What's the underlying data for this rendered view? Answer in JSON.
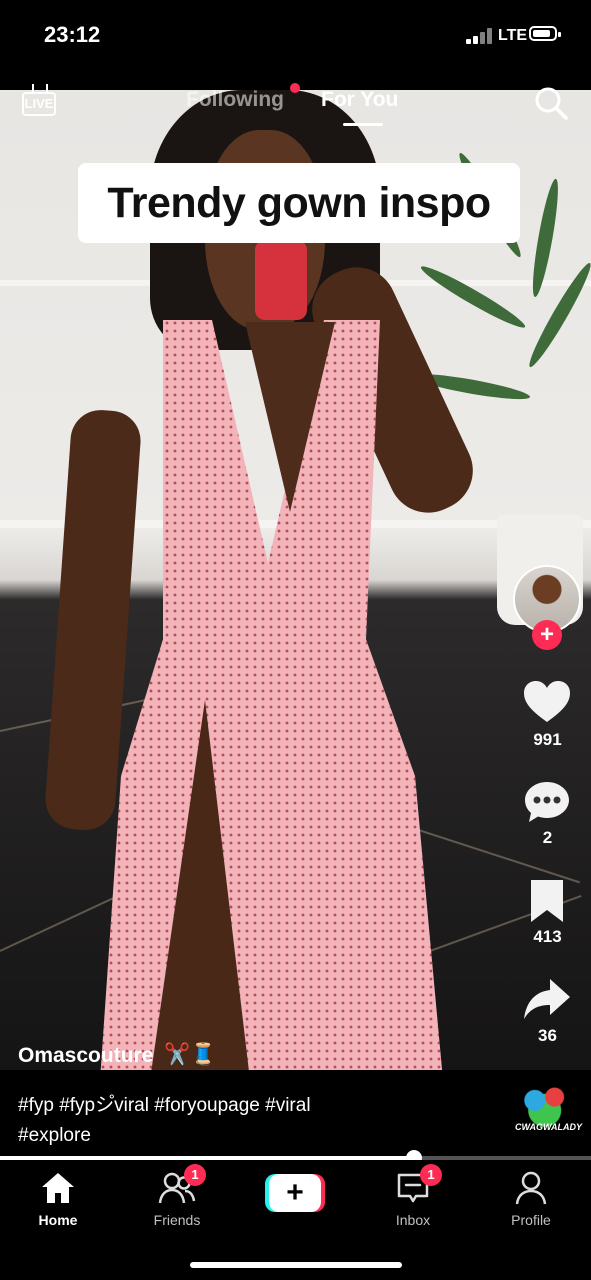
{
  "status_bar": {
    "time": "23:12",
    "network": "LTE"
  },
  "top_tabs": {
    "live_label": "LIVE",
    "following": "Following",
    "for_you": "For You"
  },
  "video": {
    "caption_overlay": "Trendy gown inspo",
    "progress": 0.7
  },
  "actions": {
    "likes": "991",
    "comments": "2",
    "saves": "413",
    "shares": "36"
  },
  "post": {
    "author": "Omascouture",
    "author_emoji": "✂️🧵",
    "description_line1": "#fyp #fypシ゚viral #foryoupage #viral",
    "description_line2": "#explore"
  },
  "music": {
    "label": "CWAGWALADY"
  },
  "bottom_nav": {
    "home": "Home",
    "friends": "Friends",
    "friends_badge": "1",
    "inbox": "Inbox",
    "inbox_badge": "1",
    "profile": "Profile"
  },
  "colors": {
    "accent": "#fe2c55",
    "cyan": "#25f4ee",
    "background": "#000000"
  },
  "icons": [
    "live-icon",
    "search-icon",
    "heart-icon",
    "comment-icon",
    "bookmark-icon",
    "share-icon",
    "home-icon",
    "friends-icon",
    "plus-icon",
    "inbox-icon",
    "profile-icon"
  ]
}
